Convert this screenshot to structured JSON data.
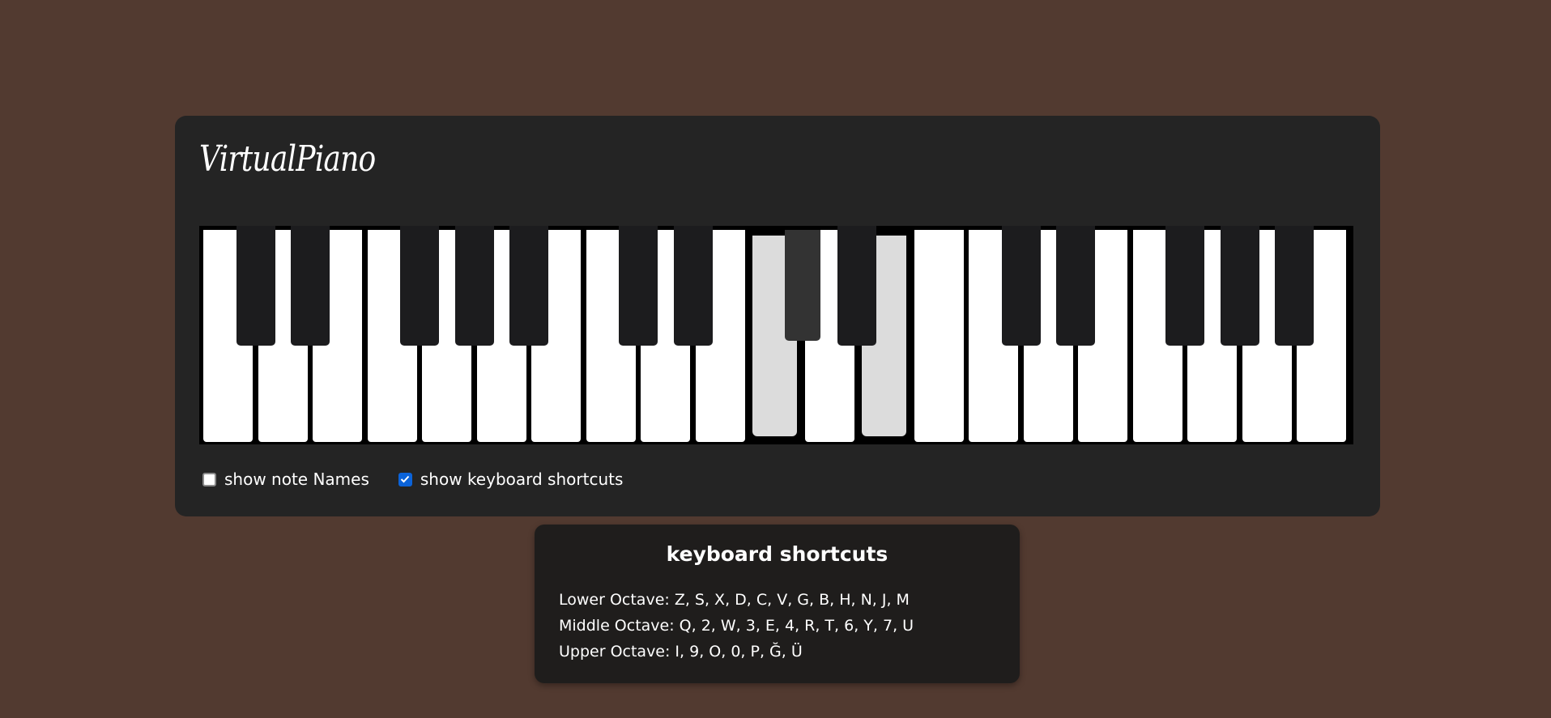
{
  "app": {
    "title": "VirtualPiano"
  },
  "keyboard": {
    "white_key_count": 21,
    "active_white_indices": [
      10,
      12
    ],
    "black_key_positions": [
      0,
      1,
      3,
      4,
      5,
      7,
      8,
      10,
      11,
      14,
      15,
      17,
      18,
      19
    ],
    "active_black_indices": [
      7
    ],
    "colors": {
      "white_key": "#ffffff",
      "white_key_pressed": "#dcdcdc",
      "black_key": "#1c1c1e",
      "black_key_pressed": "#333333"
    }
  },
  "options": {
    "note_names": {
      "label": "show note Names",
      "checked": false
    },
    "keyboard_shortcuts": {
      "label": "show keyboard shortcuts",
      "checked": true
    }
  },
  "shortcuts": {
    "title": "keyboard shortcuts",
    "lower": "Lower Octave: Z, S, X, D, C, V, G, B, H, N, J, M",
    "middle": "Middle Octave: Q, 2, W, 3, E, 4, R, T, 6, Y, 7, U",
    "upper": "Upper Octave: I, 9, O, 0, P, Ğ, Ü"
  },
  "colors": {
    "page_background": "#523a30",
    "panel_background": "#242424",
    "shortcut_box_background": "#1f1d1c",
    "checkbox_accent": "#0b63d9"
  }
}
